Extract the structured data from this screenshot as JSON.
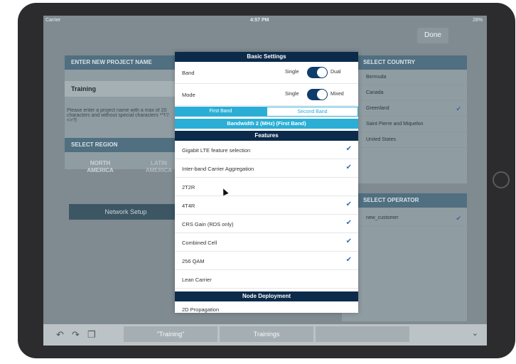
{
  "status": {
    "carrier": "Carrier",
    "time": "4:57 PM",
    "battery": "28%"
  },
  "header": {
    "done": "Done"
  },
  "left": {
    "project_title": "ENTER NEW PROJECT NAME",
    "project_value": "Training",
    "project_hint": "Please enter a project name with a max of 20 characters and without special characters *^\\\"/:<>?|",
    "region_title": "SELECT REGION",
    "regions": [
      "NORTH AMERICA",
      "LATIN AMERICA"
    ],
    "network_setup": "Network Setup"
  },
  "right": {
    "country_title": "SELECT COUNTRY",
    "countries": [
      {
        "label": "Bermuda",
        "checked": false
      },
      {
        "label": "Canada",
        "checked": false
      },
      {
        "label": "Greenland",
        "checked": true
      },
      {
        "label": "Saint Pierre and Miquelon",
        "checked": false
      },
      {
        "label": "United States",
        "checked": false
      }
    ],
    "operator_title": "SELECT OPERATOR",
    "operators": [
      {
        "label": "new_customer",
        "checked": true
      }
    ]
  },
  "modal": {
    "basic_title": "Basic Settings",
    "band": {
      "label": "Band",
      "left": "Single",
      "right": "Dual",
      "selected": "Dual"
    },
    "mode": {
      "label": "Mode",
      "left": "Single",
      "right": "Mixed",
      "selected": "Mixed"
    },
    "tabs": [
      "First Band",
      "Second Band"
    ],
    "active_tab": "First Band",
    "bandwidth": "Bandwidth 2 (MHz) (First Band)",
    "features_title": "Features",
    "features": [
      {
        "label": "Gigabit LTE feature selection",
        "checked": true
      },
      {
        "label": "Inter-band Carrier Aggregation",
        "checked": true
      },
      {
        "label": "2T2R",
        "checked": false
      },
      {
        "label": "4T4R",
        "checked": true
      },
      {
        "label": "CRS Gain (RDS only)",
        "checked": true
      },
      {
        "label": "Combined Cell",
        "checked": true
      },
      {
        "label": "256 QAM",
        "checked": true
      },
      {
        "label": "Lean Carrier",
        "checked": false
      }
    ],
    "node_title": "Node Deployment",
    "node_partial": "2D Propagation"
  },
  "keyboard_bar": {
    "suggestions": [
      "\"Training\"",
      "Trainings",
      ""
    ]
  },
  "colors": {
    "navy": "#0c2a4a",
    "accent": "#2aaed6",
    "check": "#2f6fb8"
  }
}
